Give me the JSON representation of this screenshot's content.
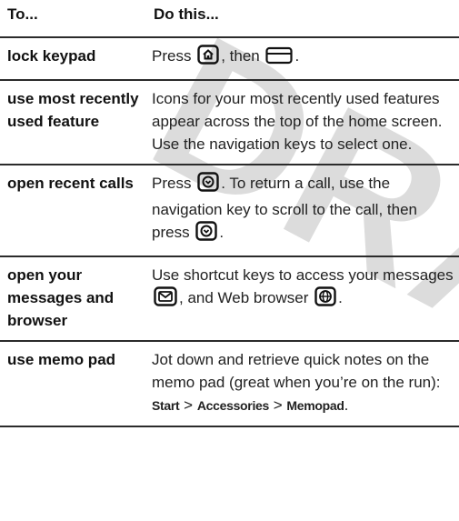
{
  "watermark": "DRAFT",
  "headers": {
    "col1": "To...",
    "col2": "Do this..."
  },
  "rows": [
    {
      "task": "lock keypad",
      "p1": "Press",
      "p2": ", then",
      "p3": "."
    },
    {
      "task": "use most recently used feature",
      "text": "Icons for your most recently used features appear across the top of the home screen. Use the navigation keys to select one."
    },
    {
      "task": "open recent calls",
      "p1": "Press",
      "p2": ". To return a call, use the navigation key to scroll to the call, then press",
      "p3": "."
    },
    {
      "task": "open your messages and browser",
      "p1": "Use shortcut keys to access your messages",
      "p2": ", and Web browser",
      "p3": "."
    },
    {
      "task": "use memo pad",
      "p1": "Jot down and retrieve quick notes on the memo pad (great when you’re on the run):",
      "menu1": "Start",
      "sep1": ">",
      "menu2": "Accessories",
      "sep2": ">",
      "menu3": "Memopad",
      "end": "."
    }
  ],
  "icons": [
    "home-key-icon",
    "soft-key-icon",
    "send-key-icon",
    "message-key-icon",
    "browser-key-icon"
  ]
}
